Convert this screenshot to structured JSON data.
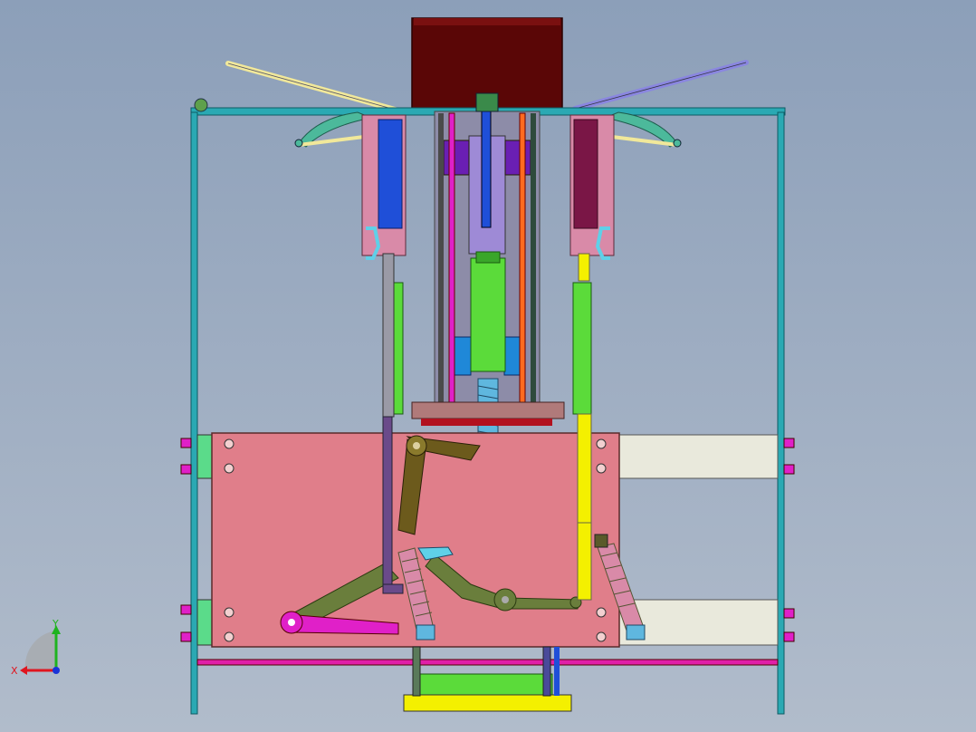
{
  "view": {
    "background_top": "#8c9fb9",
    "background_bottom": "#b1bccb"
  },
  "triad": {
    "x_label": "X",
    "y_label": "Y",
    "x_color": "#e0151f",
    "y_color": "#1fb31f",
    "z_color": "#1a34d8"
  },
  "palette": {
    "frame": "#2aa9b3",
    "top_block": "#5a0606",
    "pink_plate": "#e07e8a",
    "olive_link": "#6a7e3c",
    "dark_olive": "#6c5a1c",
    "spring": "#d98aa8",
    "spring_blue": "#5fb7df",
    "yellow": "#f4f000",
    "green": "#5bdb3a",
    "blue": "#1f4fd8",
    "purple": "#6a1fb3",
    "magenta": "#e020c8",
    "orange": "#ff6a1f",
    "maroon": "#7a1646",
    "cream": "#e9e9dc",
    "teal_lever": "#4cb99b"
  }
}
